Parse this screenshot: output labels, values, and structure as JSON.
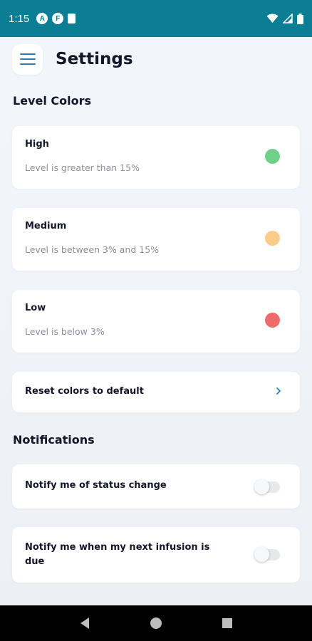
{
  "status_bar": {
    "time": "1:15",
    "badge_a": "A",
    "badge_f": "F",
    "icons": [
      "sd-card-icon",
      "wifi-icon",
      "signal-icon",
      "battery-icon"
    ]
  },
  "header": {
    "title": "Settings",
    "menu_icon": "hamburger-menu-icon"
  },
  "level_colors": {
    "title": "Level Colors",
    "items": [
      {
        "label": "High",
        "description": "Level is greater than 15%",
        "color": "#6fd08a"
      },
      {
        "label": "Medium",
        "description": "Level is between 3% and 15%",
        "color": "#fccb8a"
      },
      {
        "label": "Low",
        "description": "Level is below 3%",
        "color": "#ee6b6b"
      }
    ],
    "reset_label": "Reset colors to default",
    "reset_icon": "chevron-right-icon"
  },
  "notifications": {
    "title": "Notifications",
    "items": [
      {
        "label": "Notify me of status change",
        "enabled": false
      },
      {
        "label": "Notify me when my next infusion is due",
        "enabled": false
      }
    ]
  },
  "nav_bar": {
    "icons": [
      "back-icon",
      "home-icon",
      "recents-icon"
    ]
  },
  "colors": {
    "status_bar": "#0b7e96",
    "accent": "#2c7fb0"
  }
}
